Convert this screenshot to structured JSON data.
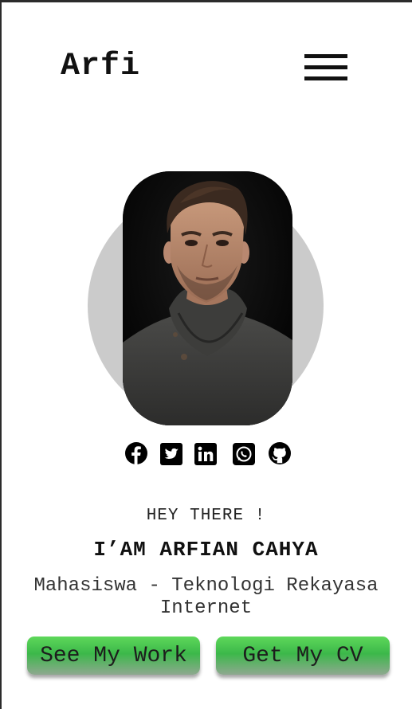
{
  "header": {
    "logo": "Arfi",
    "menu_icon": "hamburger-menu-icon"
  },
  "hero": {
    "photo": "portrait-photo",
    "greeting": "HEY THERE !",
    "name": "I’AM ARFIAN CAHYA",
    "role": "Mahasiswa - Teknologi Rekayasa Internet"
  },
  "socials": [
    {
      "icon": "facebook-icon"
    },
    {
      "icon": "twitter-icon"
    },
    {
      "icon": "linkedin-icon"
    },
    {
      "icon": "whatsapp-icon"
    },
    {
      "icon": "github-icon"
    }
  ],
  "buttons": {
    "work_label": "See My Work",
    "cv_label": "Get My CV"
  },
  "colors": {
    "button_green": "#4cc552",
    "avatar_circle": "#cbcbcb",
    "text": "#111111"
  }
}
